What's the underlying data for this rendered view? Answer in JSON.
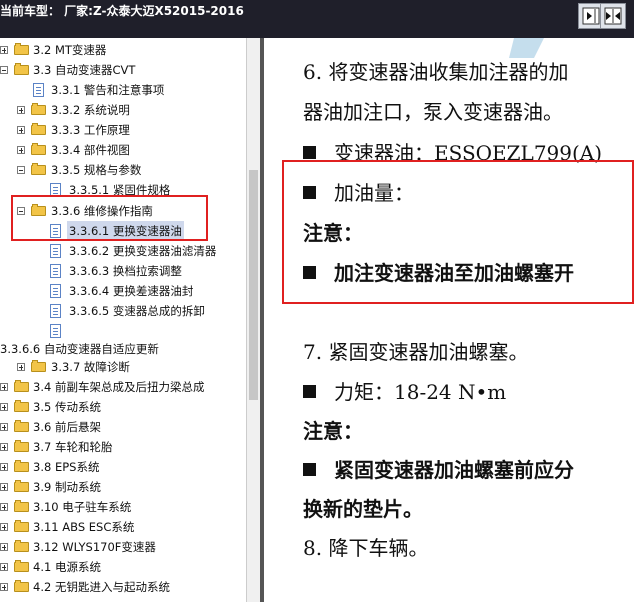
{
  "header": {
    "title": "当前车型： 厂家:Z-众泰大迈X52015-2016",
    "btn_left": "expand-right-icon",
    "btn_right": "split-view-icon"
  },
  "tree": {
    "items": [
      {
        "label": "3.2 MT变速器"
      },
      {
        "label": "3.3 自动变速器CVT"
      },
      {
        "label": "3.3.1 警告和注意事项"
      },
      {
        "label": "3.3.2 系统说明"
      },
      {
        "label": "3.3.3 工作原理"
      },
      {
        "label": "3.3.4 部件视图"
      },
      {
        "label": "3.3.5 规格与参数"
      },
      {
        "label": "3.3.5.1 紧固件规格"
      },
      {
        "label": "3.3.6 维修操作指南"
      },
      {
        "label": "3.3.6.1 更换变速器油"
      },
      {
        "label": "3.3.6.2 更换变速器油滤清器"
      },
      {
        "label": "3.3.6.3 换档拉索调整"
      },
      {
        "label": "3.3.6.4 更换差速器油封"
      },
      {
        "label": "3.3.6.5 变速器总成的拆卸"
      },
      {
        "label": ""
      },
      {
        "label": "3.3.6.6 自动变速器自适应更新"
      },
      {
        "label": "3.3.7 故障诊断"
      },
      {
        "label": "3.4 前副车架总成及后扭力梁总成"
      },
      {
        "label": "3.5 传动系统"
      },
      {
        "label": "3.6 前后悬架"
      },
      {
        "label": "3.7 车轮和轮胎"
      },
      {
        "label": "3.8 EPS系统"
      },
      {
        "label": "3.9 制动系统"
      },
      {
        "label": "3.10 电子驻车系统"
      },
      {
        "label": "3.11 ABS ESC系统"
      },
      {
        "label": "3.12 WLYS170F变速器"
      },
      {
        "label": "4.1 电源系统"
      },
      {
        "label": "4.2 无钥匙进入与起动系统"
      }
    ]
  },
  "content": {
    "lines": [
      "6. 将变速器油收集加注器的加",
      "器油加注口，泵入变速器油。",
      "变速器油：ESSOEZL799(A)",
      "加油量：",
      "注意：",
      "加注变速器油至加油螺塞开",
      "7. 紧固变速器加油螺塞。",
      "力矩：18-24 N•m",
      "注意：",
      "紧固变速器加油螺塞前应分",
      "换新的垫片。",
      "8. 降下车辆。"
    ]
  },
  "colors": {
    "highlight_box": "#e02020",
    "selected_bg": "#cfd8ec",
    "header_bg": "#1f1f2a"
  }
}
